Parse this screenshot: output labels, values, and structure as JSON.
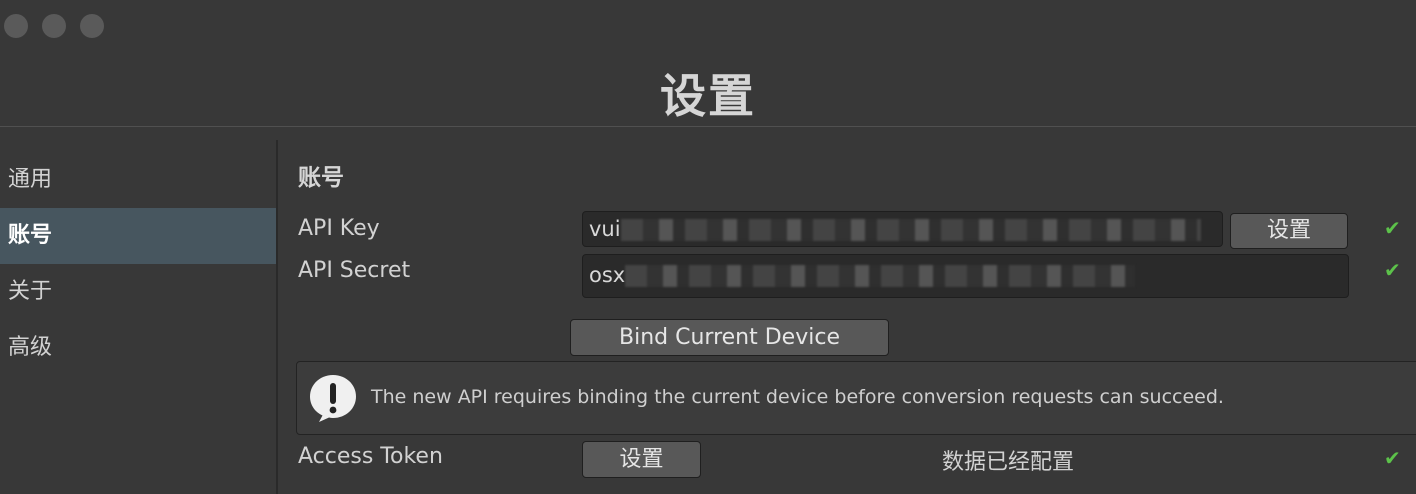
{
  "window": {
    "title": "设置"
  },
  "sidebar": {
    "items": [
      {
        "label": "通用"
      },
      {
        "label": "账号"
      },
      {
        "label": "关于"
      },
      {
        "label": "高级"
      }
    ]
  },
  "account": {
    "section_title": "账号",
    "api_key": {
      "label": "API Key",
      "value_visible": "vui",
      "button_label": "设置",
      "status": "ok"
    },
    "api_secret": {
      "label": "API Secret",
      "value_visible": "osx",
      "status": "ok"
    },
    "bind_button_label": "Bind Current Device",
    "help_message": "The new API requires binding the current device before conversion requests can succeed.",
    "access_token": {
      "label": "Access Token",
      "button_label": "设置",
      "status_text": "数据已经配置",
      "status": "ok"
    }
  },
  "icons": {
    "check": "✔",
    "info": "info-bubble-icon"
  },
  "colors": {
    "background": "#383838",
    "sidebar_active": "#47565f",
    "check": "#5cc24a"
  }
}
